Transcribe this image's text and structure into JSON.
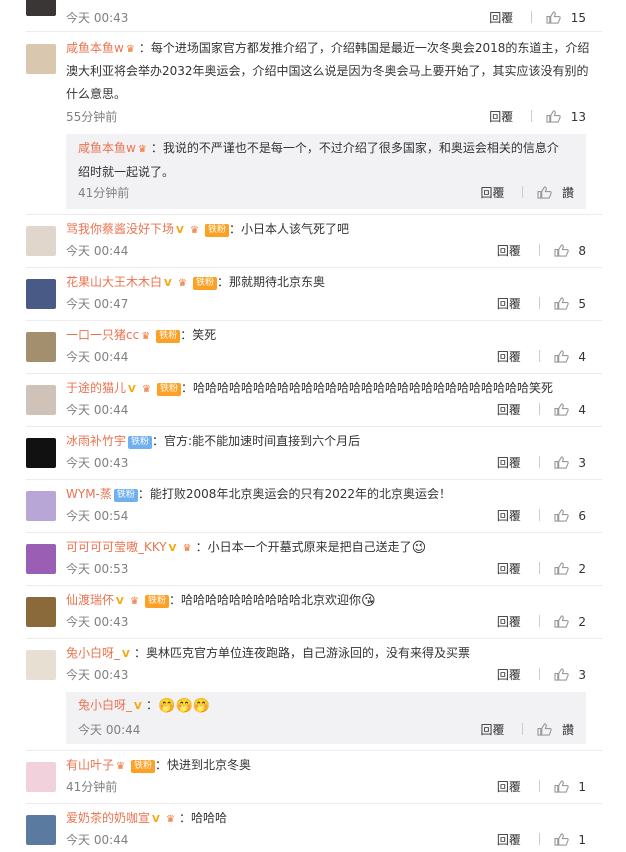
{
  "top_partial": {
    "time": "今天 00:43",
    "reply": "回覆",
    "likes": "15"
  },
  "comments": [
    {
      "user": "咸鱼本鱼w",
      "text": "：每个进场国家官方都发推介绍了，介绍韩国是最近一次冬奥会2018的东道主，介绍澳大利亚将会举办2032年奥运会，介绍中国这么说是因为冬奥会马上要开始了，其实应该没有别的什么意思。",
      "time": "55分钟前",
      "reply": "回覆",
      "likes": "13",
      "sub": {
        "user": "咸鱼本鱼w",
        "text": "：我说的不严谨也不是每一个，不过介绍了很多国家，和奥运会相关的信息介绍时就一起说了。",
        "time": "41分钟前",
        "reply": "回覆",
        "likes": "讚"
      }
    },
    {
      "user": "骂我你蔡酱没好下场",
      "badge": "铁粉",
      "text": "：小日本人该气死了吧",
      "time": "今天 00:44",
      "reply": "回覆",
      "likes": "8"
    },
    {
      "user": "花果山大王木木白",
      "badge": "铁粉",
      "text": "：那就期待北京东奥",
      "time": "今天 00:47",
      "reply": "回覆",
      "likes": "5"
    },
    {
      "user": "一口一只猪cc",
      "badge": "铁粉",
      "text": "：笑死",
      "time": "今天 00:44",
      "reply": "回覆",
      "likes": "4"
    },
    {
      "user": "于途的猫儿",
      "badge": "铁粉",
      "text": "：哈哈哈哈哈哈哈哈哈哈哈哈哈哈哈哈哈哈哈哈哈哈哈哈哈哈哈哈笑死",
      "time": "今天 00:44",
      "reply": "回覆",
      "likes": "4"
    },
    {
      "user": "冰雨补竹宇",
      "badge": "铁粉",
      "text": "：官方:能不能加速时间直接到六个月后",
      "time": "今天 00:43",
      "reply": "回覆",
      "likes": "3"
    },
    {
      "user": "WYM-蒸",
      "badge": "铁粉",
      "text": "：能打败2008年北京奥运会的只有2022年的北京奥运会！",
      "time": "今天 00:54",
      "reply": "回覆",
      "likes": "6"
    },
    {
      "user": "可可可可莹嗷_KKY",
      "text": "：小日本一个开墓式原来是把自己送走了",
      "time": "今天 00:53",
      "reply": "回覆",
      "likes": "2"
    },
    {
      "user": "仙渡瑞伓",
      "badge": "铁粉",
      "text": "：哈哈哈哈哈哈哈哈哈哈北京欢迎你",
      "time": "今天 00:43",
      "reply": "回覆",
      "likes": "2"
    },
    {
      "user": "兔小白呀_",
      "text": "：奥林匹克官方单位连夜跑路，自己游泳回的，没有来得及买票",
      "time": "今天 00:43",
      "reply": "回覆",
      "likes": "3",
      "sub": {
        "user": "兔小白呀_",
        "text": "：",
        "time": "今天 00:44",
        "reply": "回覆",
        "likes": "讚"
      }
    },
    {
      "user": "有山叶子",
      "badge": "铁粉",
      "text": "：快进到北京冬奥",
      "time": "41分钟前",
      "reply": "回覆",
      "likes": "1"
    },
    {
      "user": "爱奶茶的奶咖宣",
      "text": "：哈哈哈",
      "time": "今天 00:44",
      "reply": "回覆",
      "likes": "1"
    }
  ],
  "colors": {
    "username": "#eb7350",
    "badge": "#fca125",
    "badge_blue": "#6eb0f0",
    "time": "#808080",
    "subbox": "#f2f2f5"
  }
}
